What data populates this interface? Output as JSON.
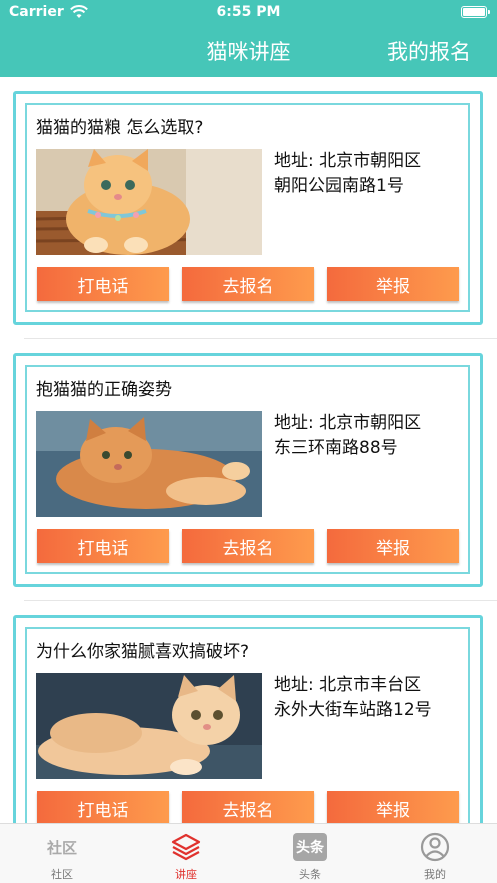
{
  "status_bar": {
    "carrier": "Carrier",
    "time": "6:55 PM"
  },
  "header": {
    "title": "猫咪讲座",
    "right_action": "我的报名"
  },
  "lectures": [
    {
      "title": "猫猫的猫粮 怎么选取?",
      "address_line1": "地址: 北京市朝阳区",
      "address_line2": "朝阳公园南路1号",
      "buttons": {
        "call": "打电话",
        "signup": "去报名",
        "report": "举报"
      }
    },
    {
      "title": "抱猫猫的正确姿势",
      "address_line1": "地址: 北京市朝阳区",
      "address_line2": "东三环南路88号",
      "buttons": {
        "call": "打电话",
        "signup": "去报名",
        "report": "举报"
      }
    },
    {
      "title": "为什么你家猫腻喜欢搞破坏?",
      "address_line1": "地址: 北京市丰台区",
      "address_line2": "永外大街车站路12号",
      "buttons": {
        "call": "打电话",
        "signup": "去报名",
        "report": "举报"
      }
    }
  ],
  "tabbar": {
    "tabs": [
      {
        "label": "社区",
        "icon_text": "社区",
        "icon": "community-icon"
      },
      {
        "label": "讲座",
        "icon": "layers-icon"
      },
      {
        "label": "头条",
        "icon_text": "头条",
        "icon": "headlines-icon"
      },
      {
        "label": "我的",
        "icon": "profile-icon"
      }
    ],
    "active_color": "#e0322e"
  },
  "colors": {
    "header": "#46c6b8",
    "frame": "#66d4dc",
    "button_start": "#f46a3d",
    "button_end": "#fe9b4d"
  }
}
